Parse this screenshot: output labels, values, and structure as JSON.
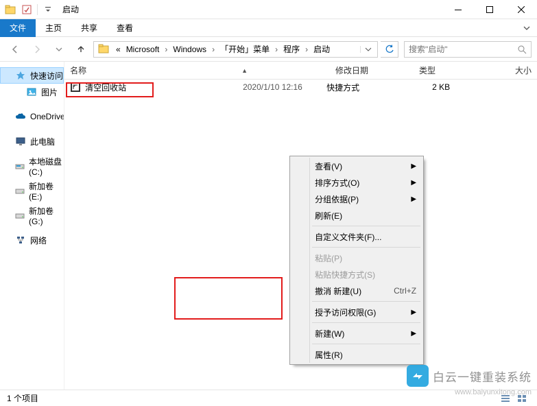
{
  "window": {
    "title": "启动"
  },
  "ribbon": {
    "file": "文件",
    "home": "主页",
    "share": "共享",
    "view": "查看"
  },
  "breadcrumb": {
    "prefix": "«",
    "items": [
      "Microsoft",
      "Windows",
      "「开始」菜单",
      "程序",
      "启动"
    ]
  },
  "search": {
    "placeholder": "搜索\"启动\""
  },
  "sidebar": {
    "quick_access": "快速访问",
    "pictures": "图片",
    "onedrive": "OneDrive",
    "this_pc": "此电脑",
    "drive_c": "本地磁盘 (C:)",
    "drive_e": "新加卷 (E:)",
    "drive_g": "新加卷 (G:)",
    "network": "网络"
  },
  "columns": {
    "name": "名称",
    "date": "修改日期",
    "type": "类型",
    "size": "大小"
  },
  "files": [
    {
      "name": "清空回收站",
      "date": "2020/1/10 12:16",
      "type": "快捷方式",
      "size": "2 KB"
    }
  ],
  "context_menu": {
    "view": "查看(V)",
    "sort": "排序方式(O)",
    "group": "分组依据(P)",
    "refresh": "刷新(E)",
    "customize": "自定义文件夹(F)...",
    "paste": "粘贴(P)",
    "paste_shortcut": "粘贴快捷方式(S)",
    "undo": "撤消 新建(U)",
    "undo_key": "Ctrl+Z",
    "grant_access": "授予访问权限(G)",
    "new": "新建(W)",
    "properties": "属性(R)"
  },
  "status": {
    "items": "1 个项目"
  },
  "watermark": {
    "text": "白云一键重装系统",
    "url": "www.baiyunxitong.com"
  }
}
